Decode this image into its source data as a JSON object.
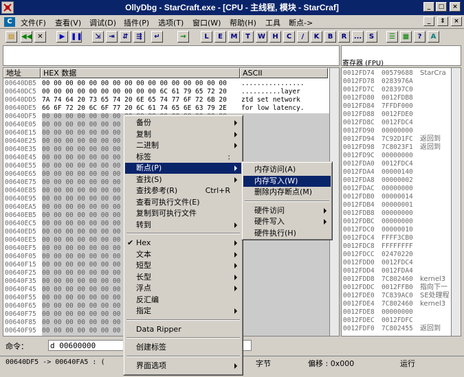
{
  "window": {
    "title": "OllyDbg - StarCraft.exe - [CPU - 主线程, 模块 - StarCraf]"
  },
  "menubar": [
    "文件(F)",
    "查看(V)",
    "调试(D)",
    "插件(P)",
    "选项(T)",
    "窗口(W)",
    "帮助(H)",
    "工具",
    "断点->"
  ],
  "toolbar_letters": [
    "L",
    "E",
    "M",
    "T",
    "W",
    "H",
    "C",
    "/",
    "K",
    "B",
    "R",
    "...",
    "S"
  ],
  "dump": {
    "headers": {
      "addr": "地址",
      "hex": "HEX 数据",
      "ascii": "ASCII"
    },
    "rows": [
      [
        "00640DB5",
        "00 00 00 00 00 00 00 00 00 00 00 00 00 00 00 00",
        "................"
      ],
      [
        "00640DC5",
        "00 00 00 00 00 00 00 00 00 00 6C 61 79 65 72 20",
        "..........layer "
      ],
      [
        "00640DD5",
        "7A 74 64 20 73 65 74 20 6E 65 74 77 6F 72 6B 20",
        "ztd set network "
      ],
      [
        "00640DE5",
        "66 6F 72 20 6C 6F 77 20 6C 61 74 65 6E 63 79 2E",
        "for low latency."
      ],
      [
        "00640DF5",
        "00 00 00 00 00 00 00 00 00 00 00 00 00 00 00 00",
        ""
      ],
      [
        "00640E05",
        "00 00 00 00 00 00 00 00 00 00 00 00 00 00 00 00",
        ""
      ],
      [
        "00640E15",
        "00 00 00 00 00 00 00 00 00 00 00 00 00 00 00 00",
        ""
      ],
      [
        "00640E25",
        "00 00 00 00 00 00 00 00 00 00 00 00 00 00 00 00",
        ""
      ],
      [
        "00640E35",
        "00 00 00 00 00 00 00 00 00 00 00 00 00 00 00 00",
        ""
      ],
      [
        "00640E45",
        "00 00 00 00 00 00 00 00 00 00 00 00 00 00 00 00",
        ""
      ],
      [
        "00640E55",
        "00 00 00 00 00 00 00 00 00 00 00 00 00 00 00 00",
        ""
      ],
      [
        "00640E65",
        "00 00 00 00 00 00 00 00 00 00 00 00 00 00 00 00",
        ""
      ],
      [
        "00640E75",
        "00 00 00 00 00 00 00 00 00 00 00 00 00 00 00 00",
        ""
      ],
      [
        "00640E85",
        "00 00 00 00 00 00 00 00 00 00 00 00 00 00 00 00",
        ""
      ],
      [
        "00640E95",
        "00 00 00 00 00 00 00 00 00 00 00 00 00 00 00 00",
        ""
      ],
      [
        "00640EA5",
        "00 00 00 00 00 00 00 00 00 00 00 00 00 00 00 00",
        ""
      ],
      [
        "00640EB5",
        "00 00 00 00 00 00 00 00 00 00 00 00 00 00 00 00",
        ""
      ],
      [
        "00640EC5",
        "00 00 00 00 00 00 00 00 00 00 00 00 00 00 00 00",
        ""
      ],
      [
        "00640ED5",
        "00 00 00 00 00 00 00 00 00 00 00 00 00 00 00 00",
        ""
      ],
      [
        "00640EE5",
        "00 00 00 00 00 00 00 00 00 00 00 00 00 00 00 00",
        ""
      ],
      [
        "00640EF5",
        "00 00 00 00 00 00 00 00 00 00 00 00 00 00 00 00",
        ""
      ],
      [
        "00640F05",
        "00 00 00 00 00 00 00 00 00 00 00 00 00 00 00 00",
        ""
      ],
      [
        "00640F15",
        "00 00 00 00 00 00 00 00 00 00 00 00 00 00 00 00",
        ""
      ],
      [
        "00640F25",
        "00 00 00 00 00 00 00 00 00 00 00 00 00 00 00 00",
        ""
      ],
      [
        "00640F35",
        "00 00 00 00 00 00 00 00 00 00 00 00 00 00 00 00",
        ""
      ],
      [
        "00640F45",
        "00 00 00 00 00 00 00 00 00 00 00 00 00 00 00 00",
        ""
      ],
      [
        "00640F55",
        "00 00 00 00 00 00 00 00 00 00 00 00 00 00 00 00",
        ""
      ],
      [
        "00640F65",
        "00 00 00 00 00 00 00 00 00 00 00 00 00 00 00 00",
        ""
      ],
      [
        "00640F75",
        "00 00 00 00 00 00 00 00 00 00 00 00 00 00 00 00",
        ""
      ],
      [
        "00640F85",
        "00 00 00 00 00 00 00 00 00 00 00 00 00 00 00 00",
        ""
      ],
      [
        "00640F95",
        "00 00 00 00 00 00 00 00 00 00 00 00 00 00 00 00",
        ""
      ]
    ]
  },
  "registers": {
    "title": "寄存器 (FPU)"
  },
  "stack": [
    [
      "0012FD74",
      "00579688",
      "StarCra"
    ],
    [
      "0012FD78",
      "0283976A",
      ""
    ],
    [
      "0012FD7C",
      "028397C0",
      ""
    ],
    [
      "0012FD80",
      "0012FDB8",
      ""
    ],
    [
      "0012FD84",
      "7FFDF000",
      ""
    ],
    [
      "0012FD88",
      "0012FDE0",
      ""
    ],
    [
      "0012FD8C",
      "0012FDC4",
      ""
    ],
    [
      "0012FD90",
      "00000000",
      ""
    ],
    [
      "0012FD94",
      "7C92D1FC",
      "返回到"
    ],
    [
      "0012FD98",
      "7C8023F1",
      "返回到"
    ],
    [
      "0012FD9C",
      "00000000",
      ""
    ],
    [
      "0012FDA0",
      "0012FDC4",
      ""
    ],
    [
      "0012FDA4",
      "00000140",
      ""
    ],
    [
      "0012FDA8",
      "00000002",
      ""
    ],
    [
      "0012FDAC",
      "00000000",
      ""
    ],
    [
      "0012FDB0",
      "00000014",
      ""
    ],
    [
      "0012FDB4",
      "00000001",
      ""
    ],
    [
      "0012FDB8",
      "00000000",
      ""
    ],
    [
      "0012FDBC",
      "00000000",
      ""
    ],
    [
      "0012FDC0",
      "00000010",
      ""
    ],
    [
      "0012FDC4",
      "FFFF3CB0",
      ""
    ],
    [
      "0012FDC8",
      "FFFFFFFF",
      ""
    ],
    [
      "0012FDCC",
      "02470220",
      ""
    ],
    [
      "0012FDD0",
      "0012FDC4",
      ""
    ],
    [
      "0012FDD4",
      "0012FDA4",
      ""
    ],
    [
      "0012FDD8",
      "7C802460",
      "kernel3"
    ],
    [
      "0012FDDC",
      "0012FFB0",
      "指向下一"
    ],
    [
      "0012FDE0",
      "7C839AC0",
      "SE处理程"
    ],
    [
      "0012FDE4",
      "7C802460",
      "kernel3"
    ],
    [
      "0012FDE8",
      "00000000",
      ""
    ],
    [
      "0012FDEC",
      "0012FDFC",
      ""
    ],
    [
      "0012FDF0",
      "7C802455",
      "返回到"
    ]
  ],
  "command": {
    "label": "命令：",
    "value": "d 00600000"
  },
  "status": {
    "range": "00640DF5 -> 00640FA5 : (",
    "unit": "字节",
    "offset_label": "偏移 : 0x000",
    "state": "运行"
  },
  "context_menu": {
    "items": [
      {
        "label": "备份",
        "submenu": true
      },
      {
        "label": "复制",
        "submenu": true
      },
      {
        "label": "二进制",
        "submenu": true
      },
      {
        "label": "标签",
        "shortcut": ":"
      },
      {
        "label": "断点(P)",
        "submenu": true,
        "selected": true
      },
      {
        "label": "查找(S)",
        "submenu": true
      },
      {
        "label": "查找参考(R)",
        "shortcut": "Ctrl+R"
      },
      {
        "label": "查看可执行文件(E)"
      },
      {
        "label": "复制到可执行文件"
      },
      {
        "label": "转到",
        "submenu": true
      },
      {
        "sep": true
      },
      {
        "label": "Hex",
        "checked": true,
        "submenu": true
      },
      {
        "label": "文本",
        "submenu": true
      },
      {
        "label": "短型",
        "submenu": true
      },
      {
        "label": "长型",
        "submenu": true
      },
      {
        "label": "浮点",
        "submenu": true
      },
      {
        "label": "反汇编"
      },
      {
        "label": "指定",
        "submenu": true
      },
      {
        "sep": true
      },
      {
        "label": "Data Ripper"
      },
      {
        "sep": true
      },
      {
        "label": "创建标签"
      },
      {
        "sep": true
      },
      {
        "label": "界面选项",
        "submenu": true
      }
    ]
  },
  "submenu": {
    "items": [
      {
        "label": "内存访问(A)"
      },
      {
        "label": "内存写入(W)",
        "selected": true
      },
      {
        "label": "删除内存断点(M)"
      },
      {
        "sep": true
      },
      {
        "label": "硬件访问",
        "submenu": true
      },
      {
        "label": "硬件写入",
        "submenu": true
      },
      {
        "label": "硬件执行(H)"
      }
    ]
  }
}
